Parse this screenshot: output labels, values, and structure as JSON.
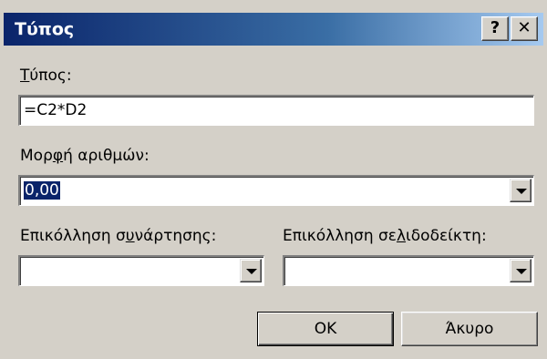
{
  "window": {
    "title": "Τύπος",
    "help_label": "?",
    "close_label": "✕"
  },
  "formula": {
    "label_underlined": "Τ",
    "label_rest": "ύπος:",
    "value": "=C2*D2"
  },
  "number_format": {
    "label_pre": "Μορ",
    "label_underlined": "φ",
    "label_post": "ή αριθμών:",
    "value": "0,00"
  },
  "paste_function": {
    "label_pre": "Επικόλληση σ",
    "label_underlined": "υ",
    "label_post": "νάρτησης:",
    "value": ""
  },
  "paste_bookmark": {
    "label_pre": "Επικόλληση σε",
    "label_underlined": "λ",
    "label_post": "ιδοδείκτη:",
    "value": ""
  },
  "buttons": {
    "ok": "OK",
    "cancel": "Άκυρο"
  }
}
